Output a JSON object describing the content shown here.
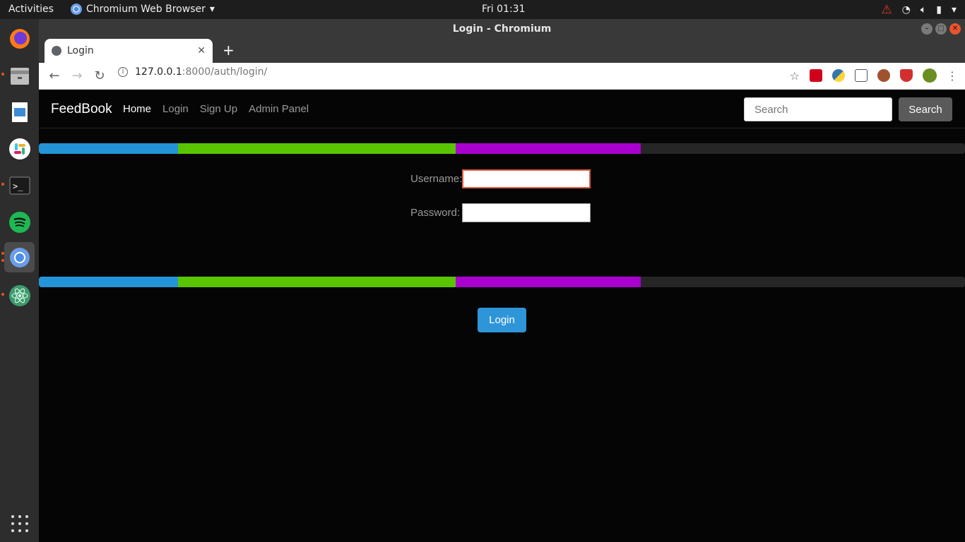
{
  "topbar": {
    "activities": "Activities",
    "app_name": "Chromium Web Browser",
    "clock": "Fri 01:31"
  },
  "dock": {
    "items": [
      "firefox-icon",
      "files-icon",
      "writer-icon",
      "slack-icon",
      "terminal-icon",
      "spotify-icon",
      "chromium-icon",
      "atom-icon"
    ]
  },
  "window": {
    "title": "Login - Chromium"
  },
  "tab": {
    "title": "Login"
  },
  "omnibox": {
    "host": "127.0.0.1",
    "path": ":8000/auth/login/"
  },
  "site": {
    "brand": "FeedBook",
    "nav": [
      {
        "label": "Home",
        "active": true
      },
      {
        "label": "Login",
        "active": false
      },
      {
        "label": "Sign Up",
        "active": false
      },
      {
        "label": "Admin Panel",
        "active": false
      }
    ],
    "search_placeholder": "Search",
    "search_button": "Search"
  },
  "colorbar": {
    "colors": [
      "#2394d8",
      "#59c500",
      "#a900d0",
      "#262626"
    ]
  },
  "form": {
    "username_label": "Username:",
    "password_label": "Password:",
    "username_value": "",
    "password_value": "",
    "login_button": "Login"
  }
}
